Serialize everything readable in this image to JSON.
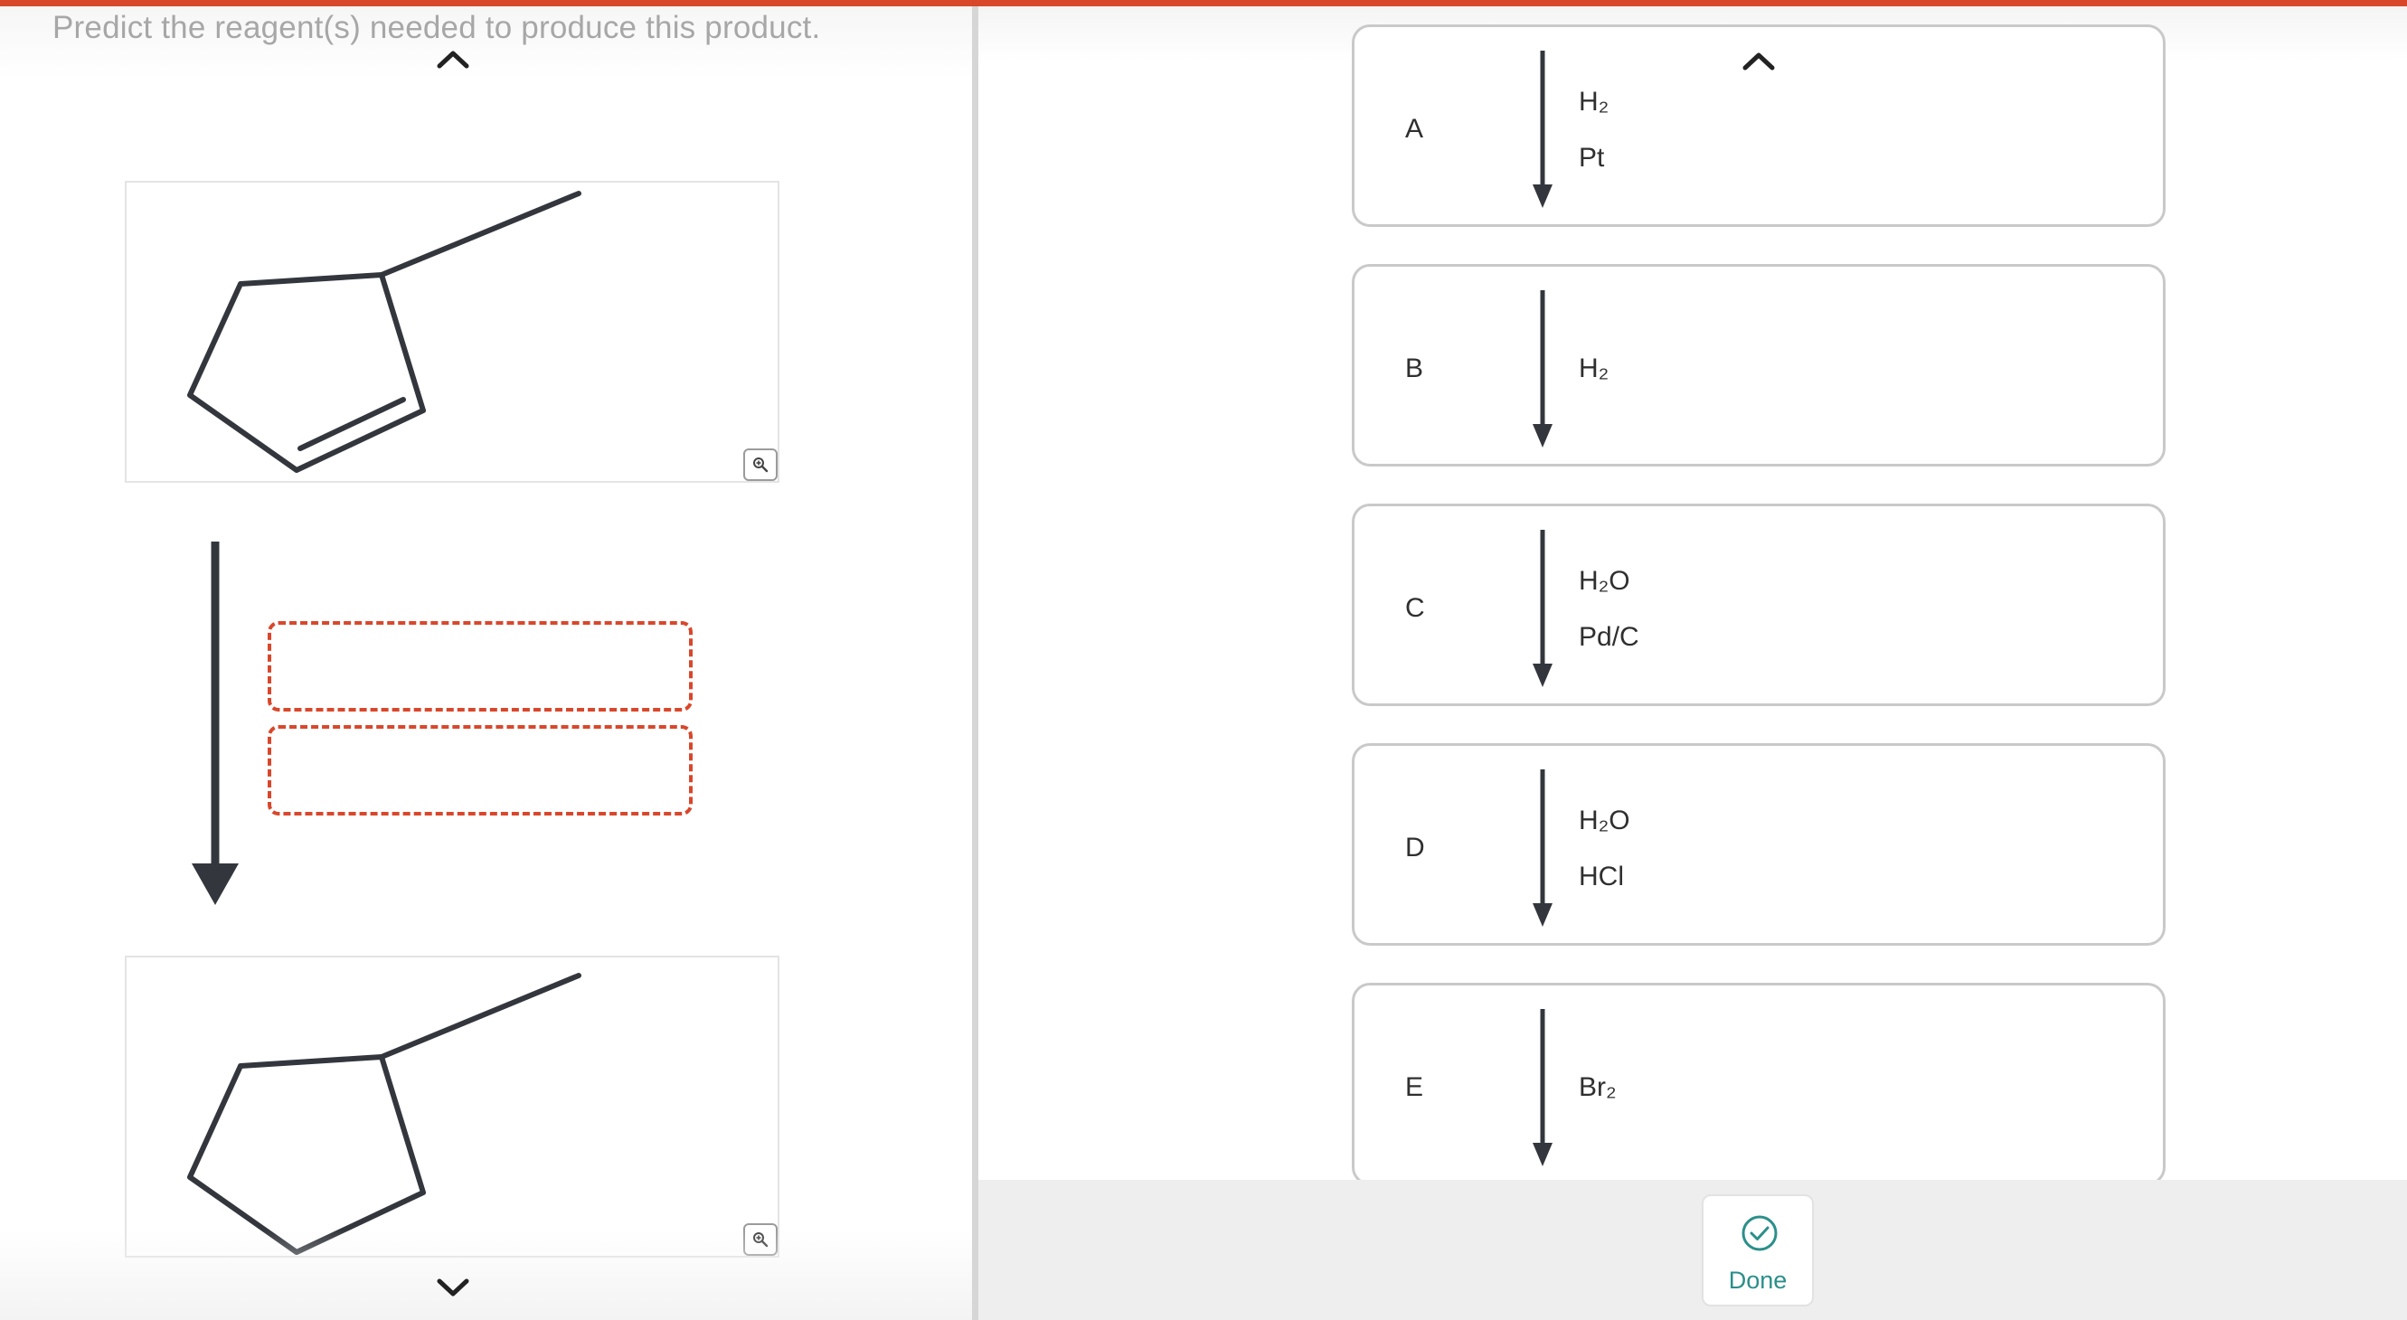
{
  "prompt": "Predict the reagent(s) needed to produce this product.",
  "icons": {
    "scroll_up": "chevron-up-icon",
    "scroll_down": "chevron-down-icon",
    "zoom": "magnifier-zoom-icon",
    "done": "checkmark-circle-icon",
    "arrow": "down-arrow-icon"
  },
  "colors": {
    "accent": "#d9472b",
    "done": "#2b8f8a",
    "structure": "#33373d"
  },
  "starting_material": {
    "name": "3-methylcyclopentene"
  },
  "product": {
    "name": "methylcyclopentane"
  },
  "drop_slots": [
    {
      "value": ""
    },
    {
      "value": ""
    }
  ],
  "options": [
    {
      "letter": "A",
      "reagent1": "H₂",
      "reagent2": "Pt"
    },
    {
      "letter": "B",
      "reagent1": "H₂",
      "reagent2": ""
    },
    {
      "letter": "C",
      "reagent1": "H₂O",
      "reagent2": "Pd/C"
    },
    {
      "letter": "D",
      "reagent1": "H₂O",
      "reagent2": "HCl"
    },
    {
      "letter": "E",
      "reagent1": "Br₂",
      "reagent2": ""
    }
  ],
  "done_label": "Done"
}
